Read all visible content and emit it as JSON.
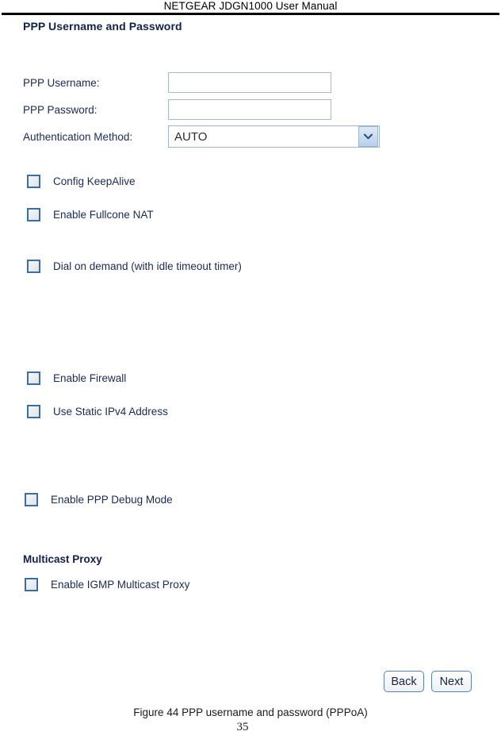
{
  "document": {
    "running_header": "NETGEAR JDGN1000 User Manual",
    "figure_caption": "Figure 44 PPP username and password (PPPoA)",
    "page_number": "35"
  },
  "screen": {
    "section_title": "PPP Username and Password",
    "fields": [
      {
        "label": "PPP Username:",
        "value": "",
        "placeholder": ""
      },
      {
        "label": "PPP Password:",
        "value": "",
        "placeholder": ""
      }
    ],
    "auth_method": {
      "label": "Authentication Method:",
      "selected": "AUTO",
      "arrow_icon": "chevron-down-icon"
    },
    "checkboxes": [
      {
        "label": "Config KeepAlive",
        "checked": false
      },
      {
        "label": "Enable Fullcone NAT",
        "checked": false
      },
      {
        "label": "Dial on demand (with idle timeout timer)",
        "checked": false
      },
      {
        "label": "Enable Firewall",
        "checked": false
      },
      {
        "label": "Use Static IPv4 Address",
        "checked": false
      },
      {
        "label": "Enable PPP Debug Mode",
        "checked": false
      }
    ],
    "multicast": {
      "group_title": "Multicast Proxy",
      "checkbox": {
        "label": "Enable IGMP Multicast Proxy",
        "checked": false
      }
    },
    "buttons": {
      "back": "Back",
      "next": "Next"
    },
    "colors": {
      "label_text": "#1b2a52",
      "heading_text": "#12204a",
      "input_border": "#a3bad4",
      "checkbox_border": "#3a6ea5",
      "button_border": "#5a81b5"
    }
  }
}
